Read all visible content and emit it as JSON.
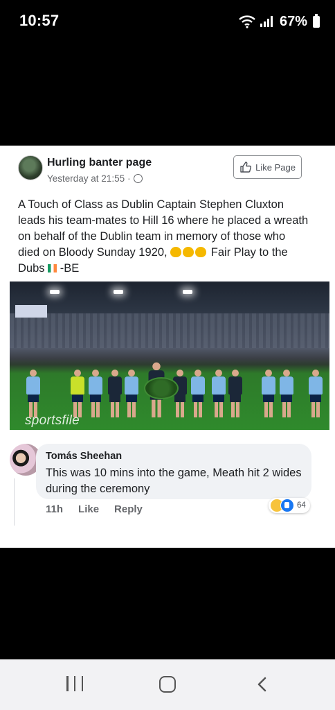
{
  "status_bar": {
    "time": "10:57",
    "battery": "67%"
  },
  "post": {
    "page_name": "Hurling banter page",
    "timestamp": "Yesterday at 21:55",
    "separator": "·",
    "like_page_label": "Like Page",
    "text_main": "A Touch of Class as Dublin Captain Stephen Cluxton leads his team-mates to Hill 16 where he placed a wreath on behalf of the Dublin team in memory of those who died on Bloody Sunday 1920,",
    "text_after_emoji": " Fair Play to the Dubs",
    "text_signoff": " -BE",
    "photo_watermark": "sportsfile"
  },
  "comment": {
    "author": "Tomás Sheehan",
    "text": "This was 10 mins into the game, Meath hit 2 wides during the ceremony",
    "time": "11h",
    "like_label": "Like",
    "reply_label": "Reply",
    "reaction_count": "64"
  },
  "colors": {
    "accent": "#1877f2",
    "bubble": "#f0f2f5",
    "meta_text": "#65676b"
  }
}
